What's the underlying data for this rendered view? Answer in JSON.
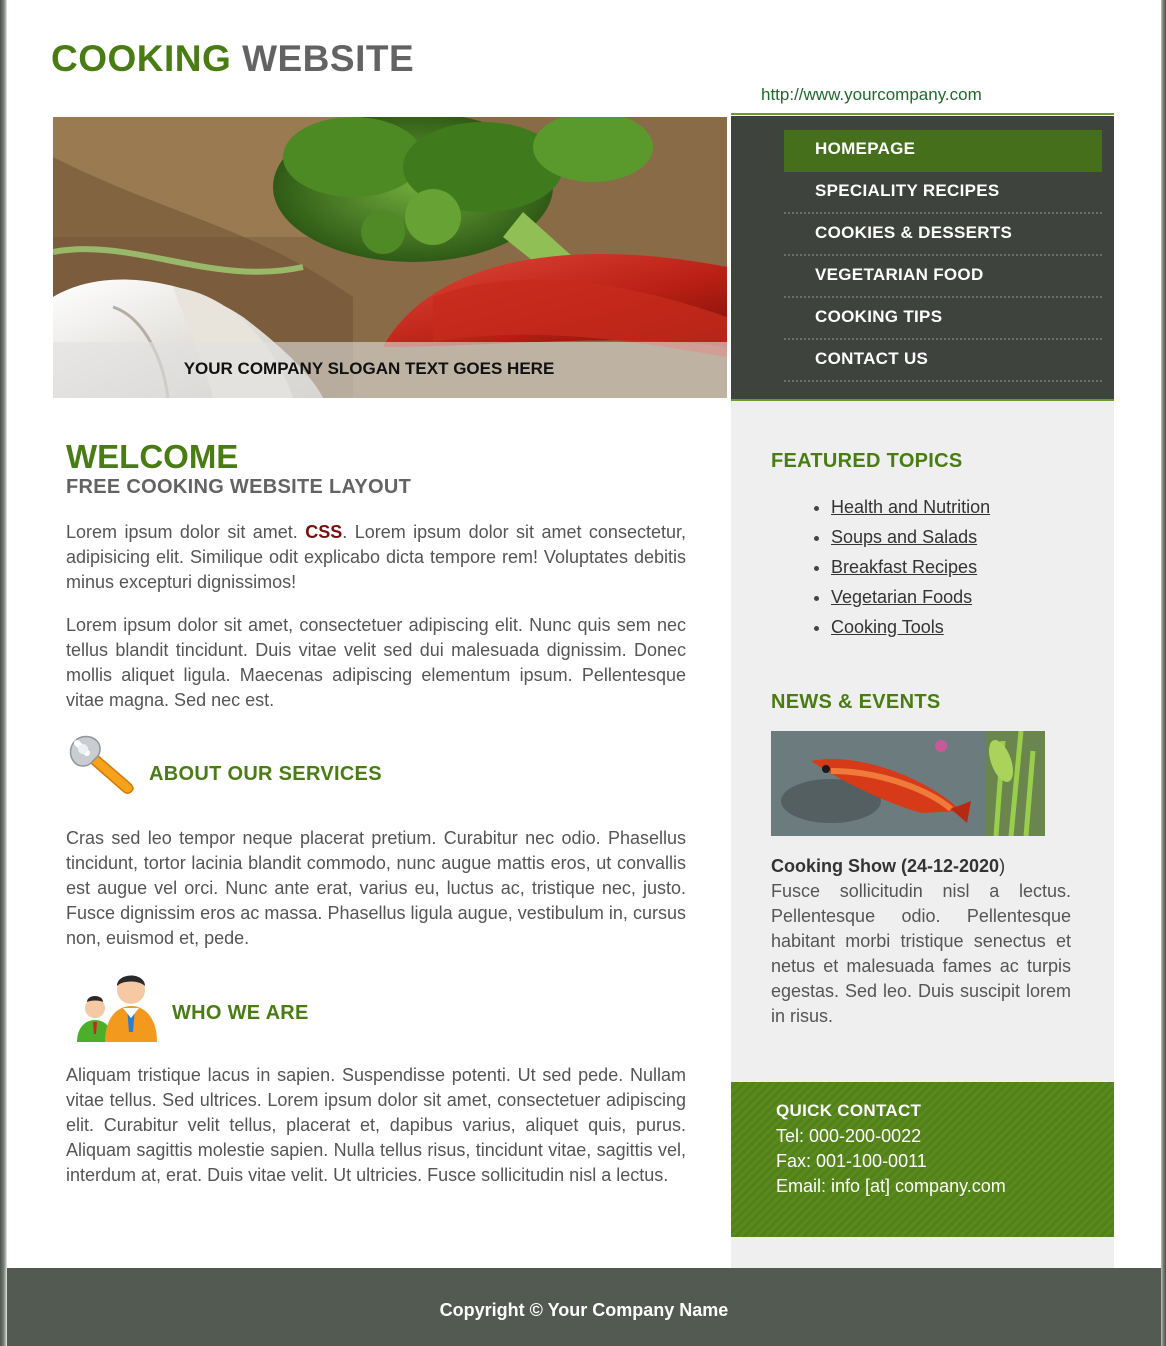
{
  "header": {
    "title_part1": "COOKING",
    "title_part2": "WEBSITE",
    "url": "http://www.yourcompany.com"
  },
  "hero": {
    "slogan": "YOUR COMPANY SLOGAN TEXT GOES HERE"
  },
  "nav": {
    "items": [
      {
        "label": "HOMEPAGE",
        "active": true
      },
      {
        "label": "SPECIALITY RECIPES"
      },
      {
        "label": "COOKIES & DESSERTS"
      },
      {
        "label": "VEGETARIAN FOOD"
      },
      {
        "label": "COOKING TIPS"
      },
      {
        "label": "CONTACT US"
      }
    ]
  },
  "main": {
    "welcome": "WELCOME",
    "subtitle": "FREE COOKING WEBSITE LAYOUT",
    "intro_before": "Lorem ipsum dolor sit amet.",
    "intro_css": "CSS",
    "intro_after": ". Lorem ipsum dolor sit amet consectetur, adipisicing elit. Similique odit explicabo dicta tempore rem! Voluptates debitis minus excepturi dignissimos!",
    "para2": "Lorem ipsum dolor sit amet, consectetuer adipiscing elit. Nunc quis sem nec tellus blandit tincidunt. Duis vitae velit sed dui malesuada dignissim. Donec mollis aliquet ligula. Maecenas adipiscing elementum ipsum. Pellentesque vitae magna. Sed nec est.",
    "services_heading": "ABOUT OUR SERVICES",
    "services_text": "Cras sed leo tempor neque placerat pretium. Curabitur nec odio. Phasellus tincidunt, tortor lacinia blandit commodo, nunc augue mattis eros, ut convallis est augue vel orci. Nunc ante erat, varius eu, luctus ac, tristique nec, justo. Fusce dignissim eros ac massa. Phasellus ligula augue, vestibulum in, cursus non, euismod et, pede.",
    "who_heading": "WHO WE ARE",
    "who_text": "Aliquam tristique lacus in sapien. Suspendisse potenti. Ut sed pede. Nullam vitae tellus. Sed ultrices. Lorem ipsum dolor sit amet, consectetuer adipiscing elit. Curabitur velit tellus, placerat et, dapibus varius, aliquet quis, purus. Aliquam sagittis molestie sapien. Nulla tellus risus, tincidunt vitae, sagittis vel, interdum at, erat. Duis vitae velit. Ut ultricies. Fusce sollicitudin nisl a lectus."
  },
  "sidebar": {
    "featured_heading": "FEATURED TOPICS",
    "topics": [
      "Health and Nutrition",
      "Soups and Salads",
      "Breakfast Recipes",
      "Vegetarian Foods",
      "Cooking Tools"
    ],
    "news_heading": "NEWS & EVENTS",
    "news_title": "Cooking Show (24-12-2020",
    "news_title_close": ")",
    "news_body": "Fusce sollicitudin nisl a lectus. Pellentesque odio. Pellentesque habitant morbi tristique senectus et netus et malesuada fames ac turpis egestas. Sed leo. Duis suscipit lorem in risus."
  },
  "quick_contact": {
    "heading": "QUICK CONTACT",
    "tel": "Tel: 000-200-0022",
    "fax": "Fax: 001-100-0011",
    "email": "Email: info [at] company.com"
  },
  "footer": {
    "copyright": "Copyright © Your Company Name"
  },
  "colors": {
    "accent_green": "#4a7c14",
    "nav_bg": "#3e433d",
    "nav_active": "#466f1c",
    "footer_bg": "#535a52"
  }
}
